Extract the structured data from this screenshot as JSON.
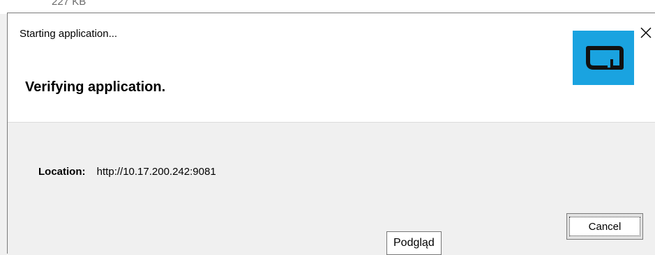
{
  "background": {
    "file_size": "227 KB"
  },
  "dialog": {
    "title": "Starting application...",
    "heading": "Verifying application.",
    "location_label": "Location:",
    "location_value": "http://10.17.200.242:9081",
    "cancel_label": "Cancel",
    "logo_icon": "app-logo-icon",
    "close_icon": "close-icon",
    "accent_color": "#1aa3e0"
  },
  "tooltip": {
    "text": "Podgląd"
  }
}
